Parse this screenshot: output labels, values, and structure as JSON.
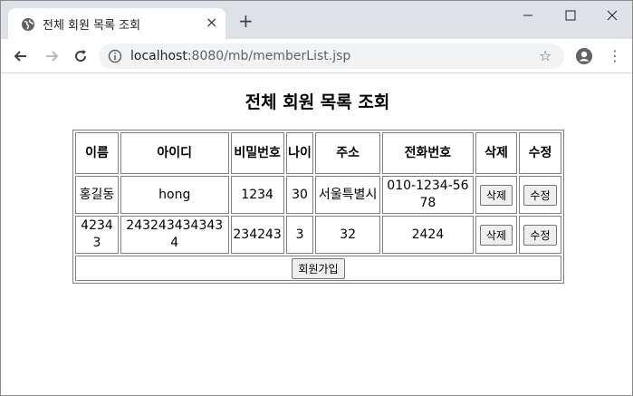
{
  "browser": {
    "tab_title": "전체 회원 목록 조회",
    "tab_close": "×",
    "new_tab": "+",
    "url_host": "localhost",
    "url_rest": ":8080/mb/memberList.jsp"
  },
  "page": {
    "title": "전체 회원 목록 조회"
  },
  "table": {
    "headers": [
      "이름",
      "아이디",
      "비밀번호",
      "나이",
      "주소",
      "전화번호",
      "삭제",
      "수정"
    ],
    "rows": [
      {
        "name": "홍길동",
        "id": "hong",
        "password": "1234",
        "age": "30",
        "address": "서울특별시",
        "phone": "010-1234-5678",
        "delete_label": "삭제",
        "edit_label": "수정"
      },
      {
        "name": "42343",
        "id": "2432434343434",
        "password": "234243",
        "age": "3",
        "address": "32",
        "phone": "2424",
        "delete_label": "삭제",
        "edit_label": "수정"
      }
    ],
    "join_label": "회원가입"
  },
  "colors": {
    "tabstrip_bg": "#dee1e6",
    "omnibox_bg": "#f1f3f4",
    "table_border": "#808080"
  }
}
